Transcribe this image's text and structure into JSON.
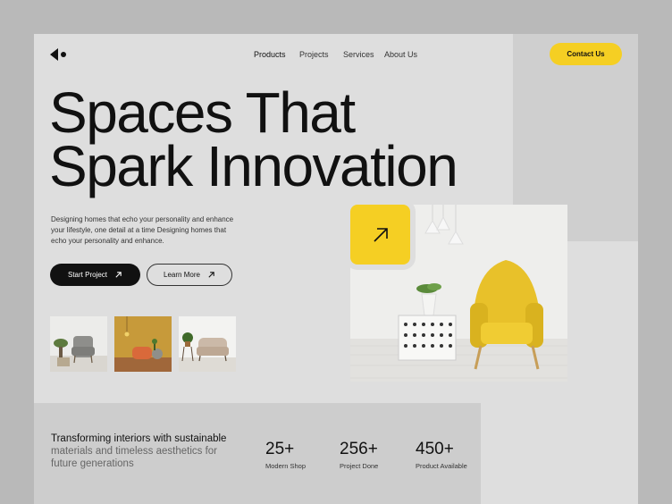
{
  "nav": {
    "items": [
      "Products",
      "Projects",
      "Services",
      "About Us"
    ],
    "contact_label": "Contact Us"
  },
  "hero": {
    "title_line1": "Spaces That",
    "title_line2": "Spark Innovation",
    "description": "Designing homes that echo your personality and enhance your lifestyle, one detail at a time Designing homes that echo your personality and enhance.",
    "primary_button": "Start Project",
    "secondary_button": "Learn More"
  },
  "tagline": {
    "strong": "Transforming interiors with sustainable",
    "muted": "materials and timeless aesthetics for future generations"
  },
  "stats": [
    {
      "value": "25+",
      "label": "Modern Shop"
    },
    {
      "value": "256+",
      "label": "Project Done"
    },
    {
      "value": "450+",
      "label": "Product Available"
    }
  ],
  "colors": {
    "accent": "#f5cf23",
    "background": "#dedede",
    "dark": "#111111"
  },
  "icons": [
    "logo-icon",
    "arrow-up-right-icon"
  ]
}
